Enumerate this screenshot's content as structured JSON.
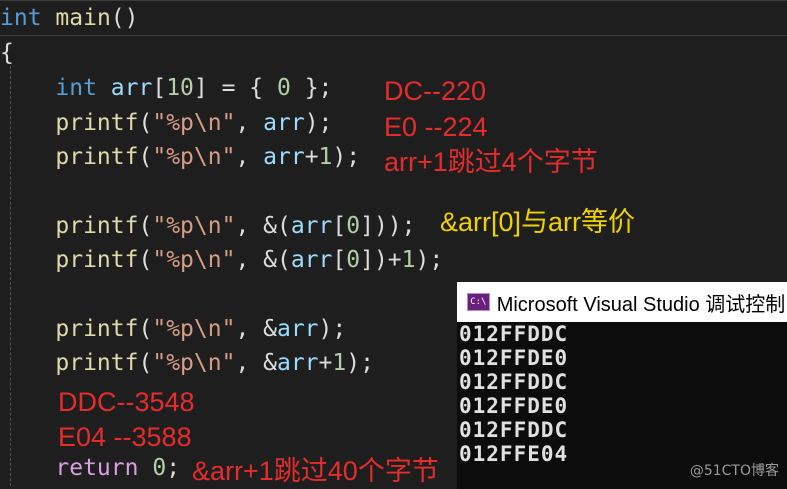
{
  "code": {
    "l1": {
      "kw": "int",
      "sp": " ",
      "fn": "main",
      "rest": "()"
    },
    "l2": {
      "brace": "{"
    },
    "l3": {
      "indent": "    ",
      "kw": "int",
      "sp": " ",
      "var": "arr",
      "p1": "[",
      "num": "10",
      "p2": "] = { ",
      "num2": "0",
      "p3": " };"
    },
    "l4": {
      "indent": "    ",
      "fn": "printf",
      "p1": "(",
      "str": "\"%p\\n\"",
      "p2": ", ",
      "var": "arr",
      "p3": ");"
    },
    "l5": {
      "indent": "    ",
      "fn": "printf",
      "p1": "(",
      "str": "\"%p\\n\"",
      "p2": ", ",
      "var": "arr",
      "p3": "+",
      "num": "1",
      "p4": ");"
    },
    "l6": {
      "indent": "    ",
      "fn": "printf",
      "p1": "(",
      "str": "\"%p\\n\"",
      "p2": ", &(",
      "var": "arr",
      "p3": "[",
      "num": "0",
      "p4": "]));"
    },
    "l7": {
      "indent": "    ",
      "fn": "printf",
      "p1": "(",
      "str": "\"%p\\n\"",
      "p2": ", &(",
      "var": "arr",
      "p3": "[",
      "num": "0",
      "p4": "])+",
      "num2": "1",
      "p5": ");"
    },
    "l8": {
      "indent": "    ",
      "fn": "printf",
      "p1": "(",
      "str": "\"%p\\n\"",
      "p2": ", &",
      "var": "arr",
      "p3": ");"
    },
    "l9": {
      "indent": "    ",
      "fn": "printf",
      "p1": "(",
      "str": "\"%p\\n\"",
      "p2": ", &",
      "var": "arr",
      "p3": "+",
      "num": "1",
      "p4": ");"
    },
    "l10": {
      "indent": "    ",
      "ctl": "return",
      "sp": " ",
      "num": "0",
      "p1": ";"
    }
  },
  "annotations": {
    "a1": "DC--220",
    "a2": "E0 --224",
    "a3": "arr+1跳过4个字节",
    "a4": "&arr[0]与arr等价",
    "a5": "DDC--3548",
    "a6": "E04 --3588",
    "a7": "&arr+1跳过40个字节"
  },
  "console": {
    "icon": "C:\\",
    "title": "Microsoft Visual Studio 调试控制台",
    "lines": [
      "012FFDDC",
      "012FFDE0",
      "012FFDDC",
      "012FFDE0",
      "012FFDDC",
      "012FFE04"
    ]
  },
  "watermark": "@51CTO博客",
  "colors": {
    "background": "#1e1e1e",
    "keyword": "#569cd6",
    "function": "#dcdcaa",
    "string": "#d69d85",
    "variable": "#9cdcfe",
    "number": "#b5cea8",
    "annotation_red": "#e52c2c",
    "annotation_yellow": "#f0d200",
    "console_bg": "#0c0c0c"
  }
}
